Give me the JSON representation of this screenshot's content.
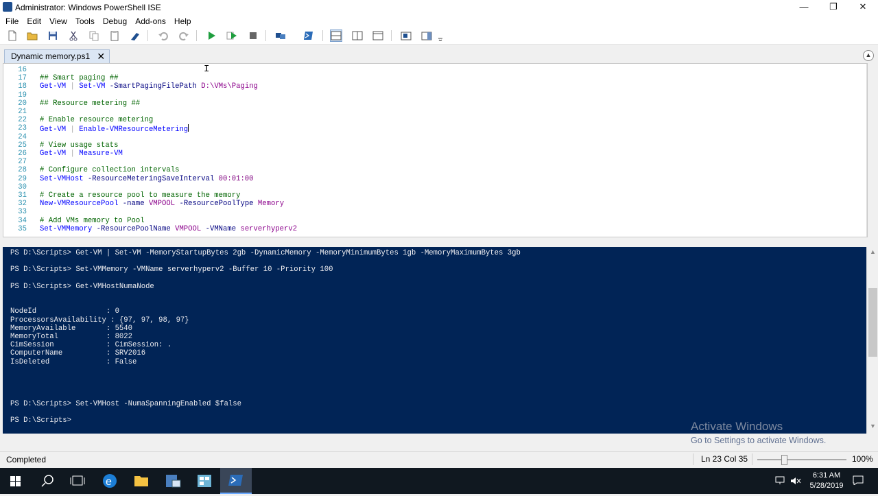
{
  "window": {
    "title": "Administrator: Windows PowerShell ISE",
    "controls": {
      "minimize": "—",
      "restore": "❐",
      "close": "✕"
    }
  },
  "menu": [
    "File",
    "Edit",
    "View",
    "Tools",
    "Debug",
    "Add-ons",
    "Help"
  ],
  "toolbar": {
    "icons": [
      "new-file-icon",
      "open-folder-icon",
      "save-icon",
      "cut-icon",
      "copy-icon",
      "paste-icon",
      "clear-console-icon",
      "undo-icon",
      "redo-icon",
      "run-script-icon",
      "run-selection-icon",
      "stop-icon",
      "new-remote-tab-icon",
      "start-powershell-icon",
      "show-script-top-icon",
      "show-script-right-icon",
      "show-script-max-icon",
      "show-command-window-icon",
      "show-command-addon-icon"
    ]
  },
  "tab": {
    "label": "Dynamic memory.ps1",
    "close": "✕"
  },
  "editor": {
    "lines": [
      {
        "n": "16",
        "tokens": []
      },
      {
        "n": "17",
        "tokens": [
          {
            "t": "## Smart paging ##",
            "c": "com"
          }
        ]
      },
      {
        "n": "18",
        "tokens": [
          {
            "t": "Get-VM",
            "c": "cmd"
          },
          {
            "t": " | ",
            "c": "op"
          },
          {
            "t": "Set-VM",
            "c": "cmd"
          },
          {
            "t": " -SmartPagingFilePath ",
            "c": "param"
          },
          {
            "t": "D:\\VMs\\Paging",
            "c": "str"
          }
        ]
      },
      {
        "n": "19",
        "tokens": []
      },
      {
        "n": "20",
        "tokens": [
          {
            "t": "## Resource metering ##",
            "c": "com"
          }
        ]
      },
      {
        "n": "21",
        "tokens": []
      },
      {
        "n": "22",
        "tokens": [
          {
            "t": "# Enable resource metering",
            "c": "com"
          }
        ]
      },
      {
        "n": "23",
        "tokens": [
          {
            "t": "Get-VM",
            "c": "cmd"
          },
          {
            "t": " | ",
            "c": "op"
          },
          {
            "t": "Enable-VMResourceMetering",
            "c": "cmd"
          }
        ]
      },
      {
        "n": "24",
        "tokens": []
      },
      {
        "n": "25",
        "tokens": [
          {
            "t": "# View usage stats",
            "c": "com"
          }
        ]
      },
      {
        "n": "26",
        "tokens": [
          {
            "t": "Get-VM",
            "c": "cmd"
          },
          {
            "t": " | ",
            "c": "op"
          },
          {
            "t": "Measure-VM",
            "c": "cmd"
          }
        ]
      },
      {
        "n": "27",
        "tokens": []
      },
      {
        "n": "28",
        "tokens": [
          {
            "t": "# Configure collection intervals",
            "c": "com"
          }
        ]
      },
      {
        "n": "29",
        "tokens": [
          {
            "t": "Set-VMHost",
            "c": "cmd"
          },
          {
            "t": " -ResourceMeteringSaveInterval ",
            "c": "param"
          },
          {
            "t": "00:01:00",
            "c": "num"
          }
        ]
      },
      {
        "n": "30",
        "tokens": []
      },
      {
        "n": "31",
        "tokens": [
          {
            "t": "# Create a resource pool to measure the memory",
            "c": "com"
          }
        ]
      },
      {
        "n": "32",
        "tokens": [
          {
            "t": "New-VMResourcePool",
            "c": "cmd"
          },
          {
            "t": " -name ",
            "c": "param"
          },
          {
            "t": "VMPOOL",
            "c": "str"
          },
          {
            "t": " -ResourcePoolType ",
            "c": "param"
          },
          {
            "t": "Memory",
            "c": "str"
          }
        ]
      },
      {
        "n": "33",
        "tokens": []
      },
      {
        "n": "34",
        "tokens": [
          {
            "t": "# Add VMs memory to Pool",
            "c": "com"
          }
        ]
      },
      {
        "n": "35",
        "tokens": [
          {
            "t": "Set-VMMemory",
            "c": "cmd"
          },
          {
            "t": " -ResourcePoolName ",
            "c": "param"
          },
          {
            "t": "VMPOOL",
            "c": "str"
          },
          {
            "t": " -VMName ",
            "c": "param"
          },
          {
            "t": "serverhyperv2",
            "c": "str"
          }
        ]
      }
    ]
  },
  "console": {
    "lines": [
      "PS D:\\Scripts> Get-VM | Set-VM -MemoryStartupBytes 2gb -DynamicMemory -MemoryMinimumBytes 1gb -MemoryMaximumBytes 3gb",
      "",
      "PS D:\\Scripts> Set-VMMemory -VMName serverhyperv2 -Buffer 10 -Priority 100",
      "",
      "PS D:\\Scripts> Get-VMHostNumaNode",
      "",
      "",
      "NodeId                : 0",
      "ProcessorsAvailability : {97, 97, 98, 97}",
      "MemoryAvailable       : 5540",
      "MemoryTotal           : 8022",
      "CimSession            : CimSession: .",
      "ComputerName          : SRV2016",
      "IsDeleted             : False",
      "",
      "",
      "",
      "",
      "PS D:\\Scripts> Set-VMHost -NumaSpanningEnabled $false",
      "",
      "PS D:\\Scripts> "
    ]
  },
  "watermark": {
    "title": "Activate Windows",
    "subtitle": "Go to Settings to activate Windows."
  },
  "status": {
    "text": "Completed",
    "position": "Ln 23  Col 35",
    "zoom": "100%",
    "zoom_fraction": 0.3
  },
  "taskbar": {
    "icons": [
      "windows-start-icon",
      "search-icon",
      "task-view-icon",
      "edge-icon",
      "file-explorer-icon",
      "server-manager-icon",
      "hyper-v-manager-icon",
      "powershell-ise-icon"
    ],
    "time": "6:31 AM",
    "date": "5/28/2019"
  }
}
